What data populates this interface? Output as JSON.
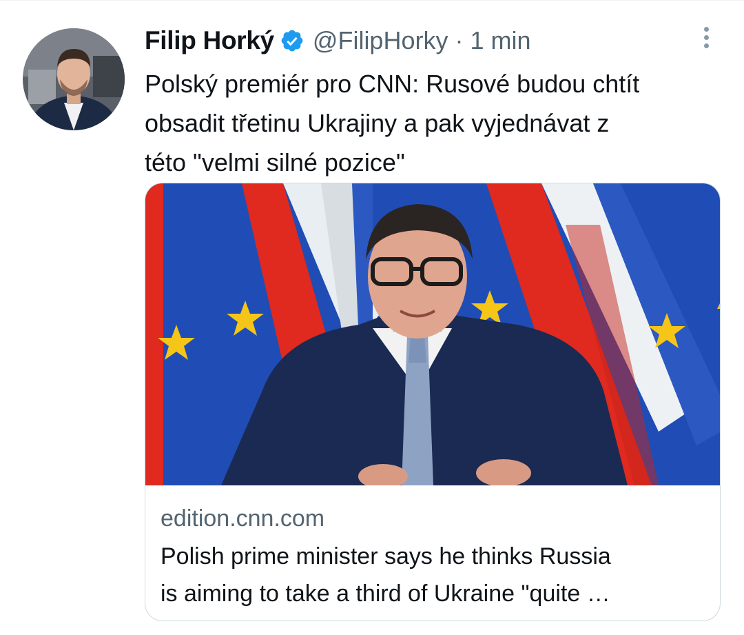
{
  "tweet": {
    "author_name": "Filip Horký",
    "handle": "@FilipHorky",
    "separator": "·",
    "time": "1 min",
    "verified": true,
    "text_lines": [
      "Polský premiér pro CNN: Rusové budou chtít",
      "obsadit třetinu Ukrajiny a pak vyjednávat z",
      "této \"velmi silné pozice\""
    ]
  },
  "card": {
    "domain": "edition.cnn.com",
    "title_lines": [
      "Polish prime minister says he thinks Russia",
      "is aiming to take a third of Ukraine \"quite …"
    ]
  },
  "icons": {
    "verified": "verified-badge-icon",
    "more": "more-options-icon"
  },
  "colors": {
    "verified_blue": "#1d9bf0",
    "secondary_text": "#536471",
    "primary_text": "#0f1419",
    "border": "#cfd9de",
    "eu_blue": "#1f4db5",
    "poland_red": "#e0291f",
    "star_gold": "#f5c518"
  }
}
